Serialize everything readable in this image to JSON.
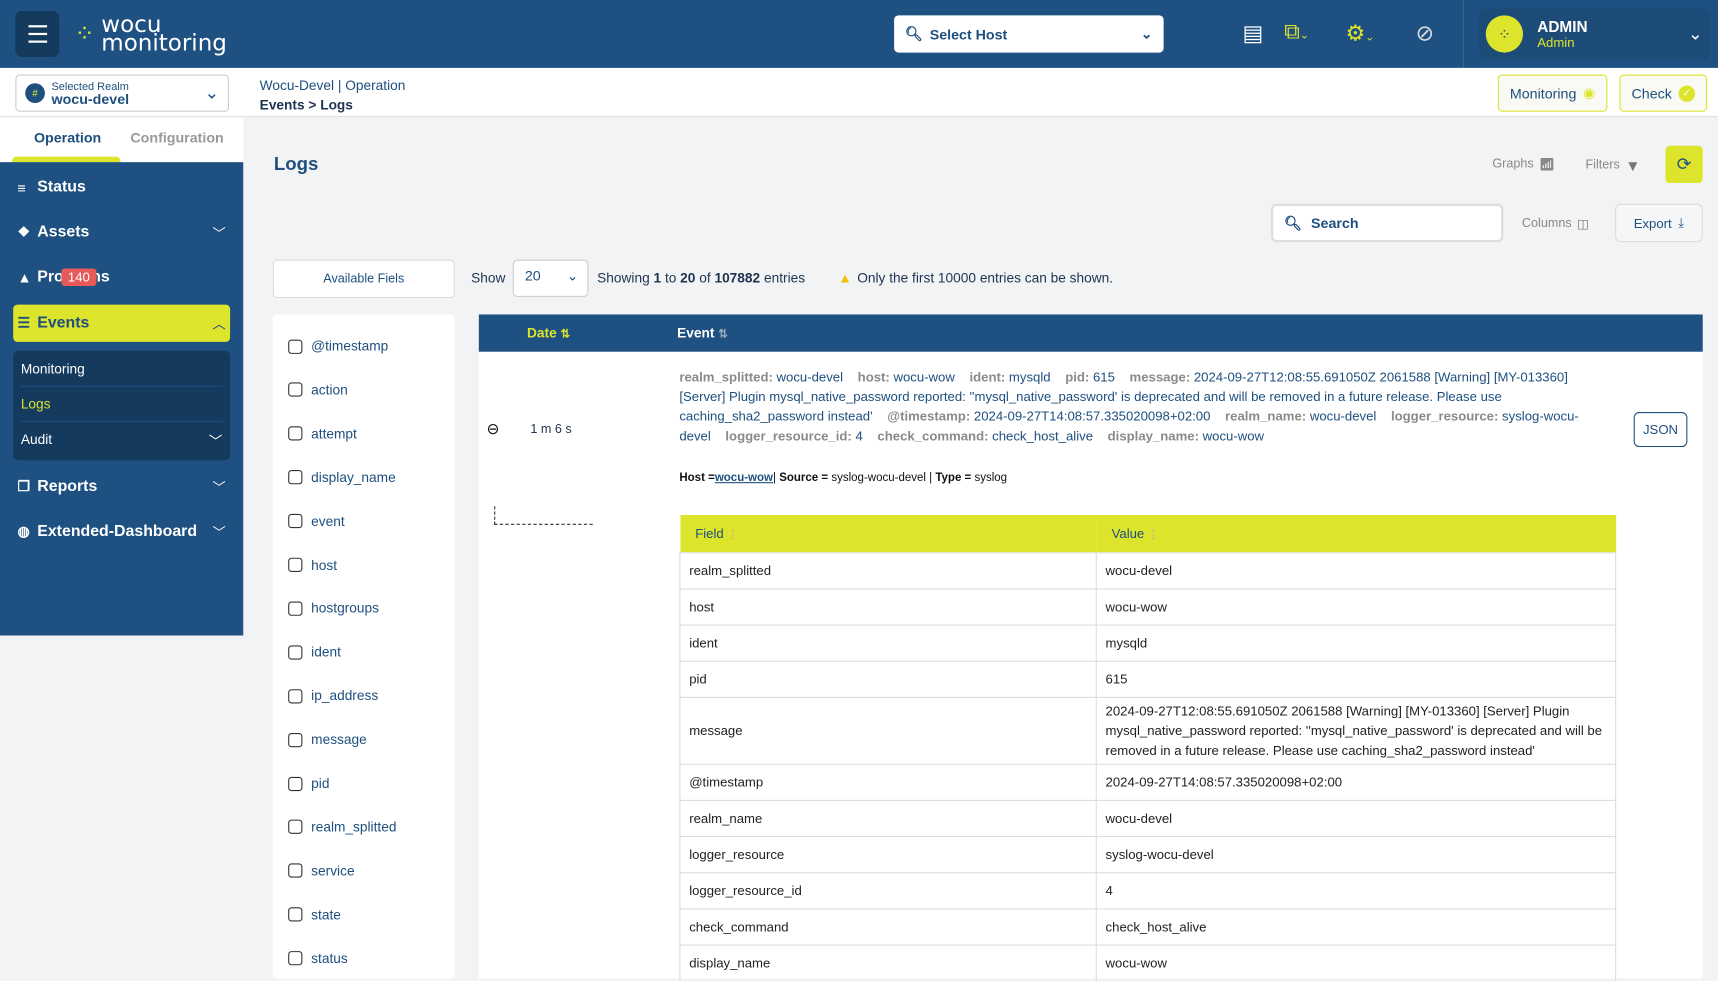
{
  "header": {
    "logo_line1": "wocu",
    "logo_line2": "monitoring",
    "host_select": "Select Host",
    "user_name": "ADMIN",
    "user_role": "Admin"
  },
  "realm": {
    "label": "Selected Realm",
    "value": "wocu-devel"
  },
  "breadcrumb": {
    "line1_a": "Wocu-Devel",
    "sep": "|",
    "line1_b": "Operation",
    "line2": "Events > Logs"
  },
  "top_buttons": {
    "monitoring": "Monitoring",
    "check": "Check"
  },
  "sidebar": {
    "tabs": [
      "Operation",
      "Configuration"
    ],
    "items": [
      {
        "label": "Status"
      },
      {
        "label": "Assets"
      },
      {
        "label": "Problems",
        "badge": "140"
      },
      {
        "label": "Events"
      },
      {
        "label": "Reports"
      },
      {
        "label": "Extended-Dashboard"
      }
    ],
    "sub_items": [
      "Monitoring",
      "Logs",
      "Audit"
    ]
  },
  "page": {
    "title": "Logs",
    "graphs": "Graphs",
    "filters": "Filters",
    "search_placeholder": "Search",
    "columns": "Columns",
    "export": "Export",
    "available_fields": "Available Fiels",
    "show": "Show",
    "page_size": "20",
    "showing_pre": "Showing ",
    "showing_from": "1",
    "showing_to_word": " to ",
    "showing_to": "20",
    "showing_of": " of ",
    "showing_total": "107882",
    "showing_post": " entries",
    "warning": "Only the first 10000 entries can be shown."
  },
  "fields": [
    "@timestamp",
    "action",
    "attempt",
    "display_name",
    "event",
    "host",
    "hostgroups",
    "ident",
    "ip_address",
    "message",
    "pid",
    "realm_splitted",
    "service",
    "state",
    "status"
  ],
  "table": {
    "columns": [
      "Date",
      "Event"
    ],
    "row": {
      "date": "1 m 6 s",
      "json_button": "JSON",
      "event_pairs": [
        [
          "realm_splitted:",
          "wocu-devel"
        ],
        [
          "host:",
          "wocu-wow"
        ],
        [
          "ident:",
          "mysqld"
        ],
        [
          "pid:",
          "615"
        ],
        [
          "message:",
          "2024-09-27T12:08:55.691050Z 2061588 [Warning] [MY-013360] [Server] Plugin mysql_native_password reported: ''mysql_native_password' is deprecated and will be removed in a future release. Please use caching_sha2_password instead'"
        ],
        [
          "@timestamp:",
          "2024-09-27T14:08:57.335020098+02:00"
        ],
        [
          "realm_name:",
          "wocu-devel"
        ],
        [
          "logger_resource:",
          "syslog-wocu-devel"
        ],
        [
          "logger_resource_id:",
          "4"
        ],
        [
          "check_command:",
          "check_host_alive"
        ],
        [
          "display_name:",
          "wocu-wow"
        ]
      ],
      "host_label": "Host =",
      "host_link": "wocu-wow",
      "source_label": "Source =",
      "source": "syslog-wocu-devel",
      "type_label": "Type =",
      "type": "syslog",
      "detail_headers": [
        "Field",
        "Value"
      ],
      "detail": [
        [
          "realm_splitted",
          "wocu-devel"
        ],
        [
          "host",
          "wocu-wow"
        ],
        [
          "ident",
          "mysqld"
        ],
        [
          "pid",
          "615"
        ],
        [
          "message",
          "2024-09-27T12:08:55.691050Z 2061588 [Warning] [MY-013360] [Server] Plugin mysql_native_password reported: ''mysql_native_password' is deprecated and will be removed in a future release. Please use caching_sha2_password instead'"
        ],
        [
          "@timestamp",
          "2024-09-27T14:08:57.335020098+02:00"
        ],
        [
          "realm_name",
          "wocu-devel"
        ],
        [
          "logger_resource",
          "syslog-wocu-devel"
        ],
        [
          "logger_resource_id",
          "4"
        ],
        [
          "check_command",
          "check_host_alive"
        ],
        [
          "display_name",
          "wocu-wow"
        ]
      ]
    }
  },
  "colors": {
    "primary": "#1e5081",
    "accent": "#dde42c",
    "badge": "#e85a5a"
  }
}
